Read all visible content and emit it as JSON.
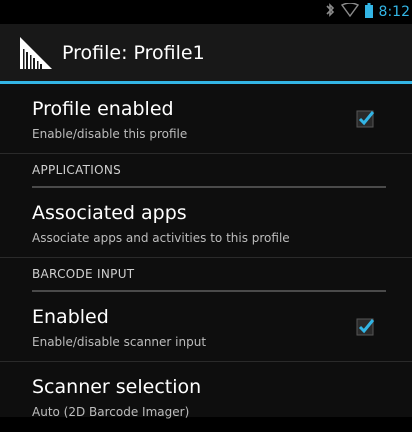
{
  "status_bar": {
    "time": "8:12",
    "icons": [
      "bluetooth-icon",
      "wifi-icon",
      "battery-icon"
    ]
  },
  "action_bar": {
    "title": "Profile: Profile1",
    "icon": "app-logo-icon"
  },
  "preferences": {
    "profile_enabled": {
      "title": "Profile enabled",
      "summary": "Enable/disable this profile",
      "checked": true
    },
    "section_applications": "APPLICATIONS",
    "associated_apps": {
      "title": "Associated apps",
      "summary": "Associate apps and activities to this profile"
    },
    "section_barcode": "BARCODE INPUT",
    "barcode_enabled": {
      "title": "Enabled",
      "summary": "Enable/disable scanner input",
      "checked": true
    },
    "scanner_selection": {
      "title": "Scanner selection",
      "summary": "Auto (2D Barcode Imager)"
    }
  },
  "colors": {
    "accent": "#33b5e5",
    "background": "#0e0e0e",
    "action_bar": "#181818"
  }
}
